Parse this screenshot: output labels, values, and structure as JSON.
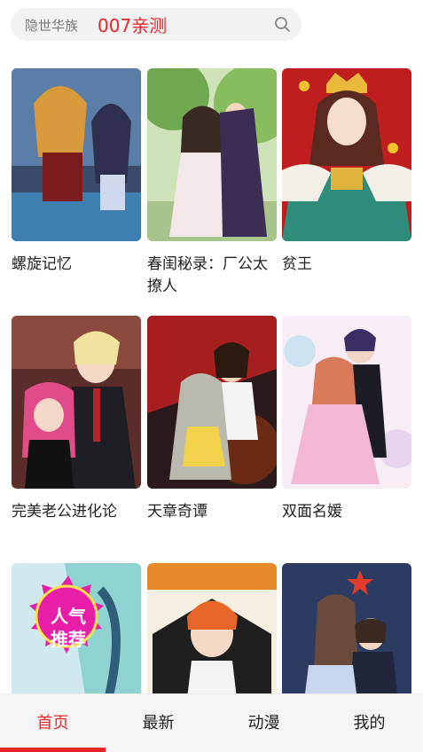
{
  "search": {
    "placeholder": "隐世华族",
    "value": "007亲测",
    "icon": "search-icon"
  },
  "comics": [
    {
      "title": "螺旋记忆"
    },
    {
      "title": "春闺秘录：厂公太撩人"
    },
    {
      "title": "贫王"
    },
    {
      "title": "完美老公进化论"
    },
    {
      "title": "天章奇谭"
    },
    {
      "title": "双面名媛"
    },
    {
      "title": "",
      "badge_line1": "人气",
      "badge_line2": "推荐"
    },
    {
      "title": ""
    },
    {
      "title": ""
    }
  ],
  "tabs": [
    {
      "label": "首页",
      "active": true
    },
    {
      "label": "最新",
      "active": false
    },
    {
      "label": "动漫",
      "active": false
    },
    {
      "label": "我的",
      "active": false
    }
  ],
  "colors": {
    "accent": "#e8262a",
    "badge": "#e91ea8"
  }
}
